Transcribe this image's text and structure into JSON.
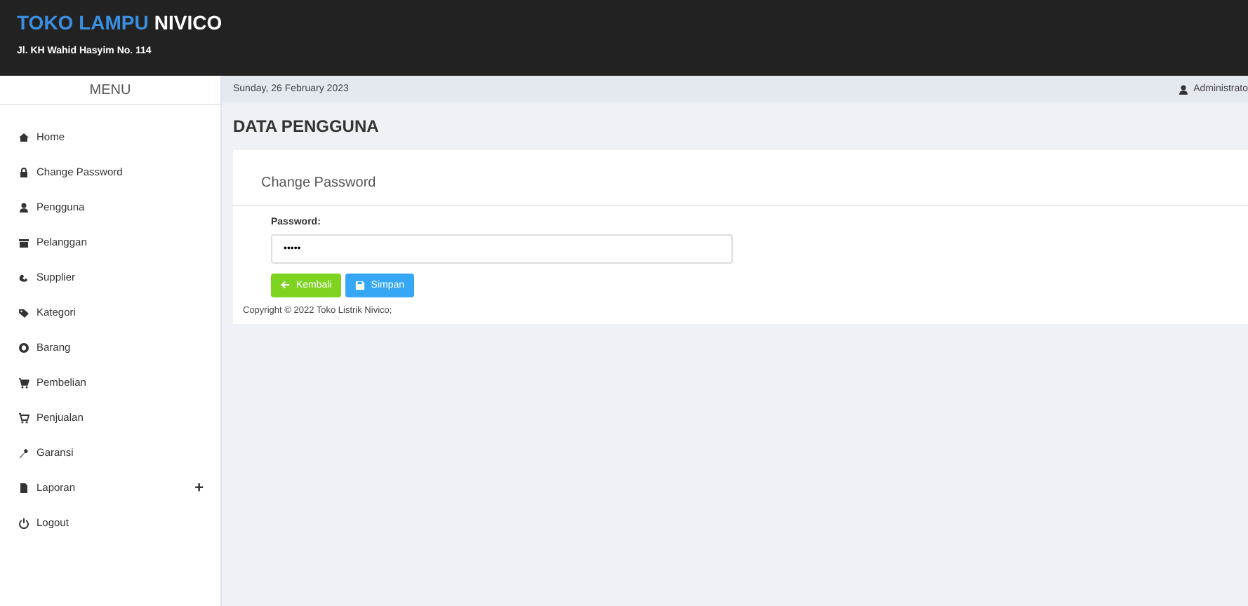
{
  "header": {
    "brand_first": "TOKO LAMPU",
    "brand_second": "NIVICO",
    "address": "Jl. KH Wahid Hasyim No. 114"
  },
  "sidebar": {
    "title": "MENU",
    "items": [
      {
        "label": "Home",
        "selected": false
      },
      {
        "label": "Change Password",
        "selected": false
      },
      {
        "label": "Pengguna",
        "selected": false
      },
      {
        "label": "Pelanggan",
        "selected": false
      },
      {
        "label": "Supplier",
        "selected": false
      },
      {
        "label": "Kategori",
        "selected": false
      },
      {
        "label": "Barang",
        "selected": false
      },
      {
        "label": "Pembelian",
        "selected": false
      },
      {
        "label": "Penjualan",
        "selected": false
      },
      {
        "label": "Garansi",
        "selected": false
      },
      {
        "label": "Laporan",
        "selected": false,
        "toggle": "+"
      },
      {
        "label": "Logout",
        "selected": false
      }
    ]
  },
  "topbar": {
    "date": "Sunday, 26 February 2023",
    "user": "Administrato"
  },
  "page_title": "DATA PENGGUNA",
  "card": {
    "title": "Change Password",
    "field": {
      "label": "Password:",
      "value": "•••••"
    },
    "buttons": [
      {
        "kind": "back",
        "label": "Kembali"
      },
      {
        "kind": "save",
        "label": "Simpan"
      }
    ]
  },
  "footer": "Copyright © 2022 Toko Listrik Nivico;"
}
